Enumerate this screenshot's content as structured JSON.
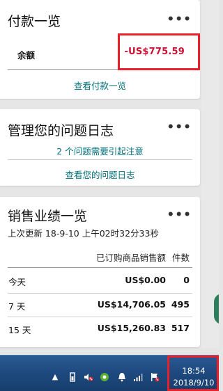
{
  "payment_card": {
    "title": "付款一览",
    "more_label": "•••",
    "balance_label": "余额",
    "balance_value": "-US$775.59",
    "link_label": "查看付款一览"
  },
  "issues_card": {
    "title": "管理您的问题日志",
    "more_label": "•••",
    "alert_label": "2 个问题需要引起注意",
    "link_label": "查看您的问题日志"
  },
  "sales_card": {
    "title": "销售业绩一览",
    "more_label": "•••",
    "last_updated": "上次更新 18-9-10 上午02时32分33秒",
    "columns": [
      "已订购商品销售额",
      "件数"
    ],
    "rows": [
      {
        "period": "今天",
        "amount": "US$0.00",
        "count": "0"
      },
      {
        "period": "7 天",
        "amount": "US$14,706.05",
        "count": "495"
      },
      {
        "period": "15 天",
        "amount": "US$15,260.83",
        "count": "517"
      }
    ]
  },
  "taskbar": {
    "time": "18:54",
    "date": "2018/9/10",
    "tray_icons": [
      "chevron-up-icon",
      "battery-icon",
      "volume-muted-icon",
      "app-icon",
      "notification-icon",
      "signal-icon",
      "flag-icon"
    ],
    "colors": {
      "bar": "#1e4a80",
      "highlight": "#e8202a",
      "link": "#00707a",
      "negative": "#cc1133"
    }
  }
}
